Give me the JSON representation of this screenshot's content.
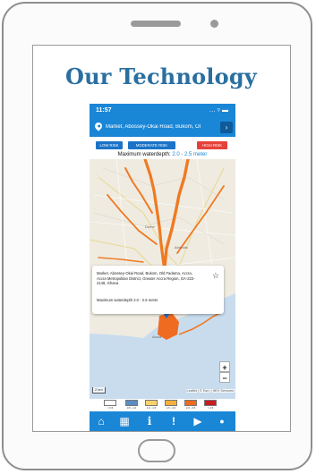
{
  "heading": "Our Technology",
  "status_bar": {
    "time": "11:57",
    "signal": "… ▿ ▬"
  },
  "address_bar": {
    "text": "Market, Abossey-Okai Road, Bukom, Ol",
    "go_label": "›"
  },
  "risk_buttons": [
    {
      "label": "LOW RISK",
      "color": "#1a73c8"
    },
    {
      "label": "MODERATE RISK",
      "color": "#1a73c8"
    },
    {
      "label": "HIGH RISK",
      "color": "#e5413a"
    }
  ],
  "depth": {
    "label": "Maximum waterdepth:",
    "value": "2.0 - 2.5 meter"
  },
  "map": {
    "place_labels": [
      "Dome",
      "Achimota",
      "Accra"
    ],
    "popup": {
      "address": "Market, Abossey-Okai Road, Bukom, Old Fadama, Accra, Accra Metropolitan District, Greater Accra Region, GA-222-2148, Ghana",
      "depth_text": "Maximum waterdepth 2.0 - 2.5 meter",
      "star": "☆"
    },
    "zoom_in": "+",
    "zoom_out": "−",
    "scale": "2 km",
    "attribution": "Leaflet | © Esri, | HEV Services"
  },
  "legend": [
    {
      "label": "< 0.5",
      "color": "#ffffff"
    },
    {
      "label": "0.5 - 1.0",
      "color": "#5b8ec5"
    },
    {
      "label": "1.0 - 1.5",
      "color": "#f7d36b"
    },
    {
      "label": "1.5 - 2.0",
      "color": "#f4b23c"
    },
    {
      "label": "2.0 - 2.5",
      "color": "#ef6b1f"
    },
    {
      "label": "> 2.5",
      "color": "#c81e1e"
    }
  ],
  "tabbar": [
    {
      "icon": "home-icon",
      "glyph": "⌂"
    },
    {
      "icon": "map-icon",
      "glyph": "▦"
    },
    {
      "icon": "info-icon",
      "glyph": "i"
    },
    {
      "icon": "alert-icon",
      "glyph": "!"
    },
    {
      "icon": "play-icon",
      "glyph": "▶"
    },
    {
      "icon": "water-drop-icon",
      "glyph": "●"
    }
  ],
  "colors": {
    "brand": "#1a86d6",
    "heading": "#2a6fa0",
    "flood": "#ef6b1f"
  }
}
